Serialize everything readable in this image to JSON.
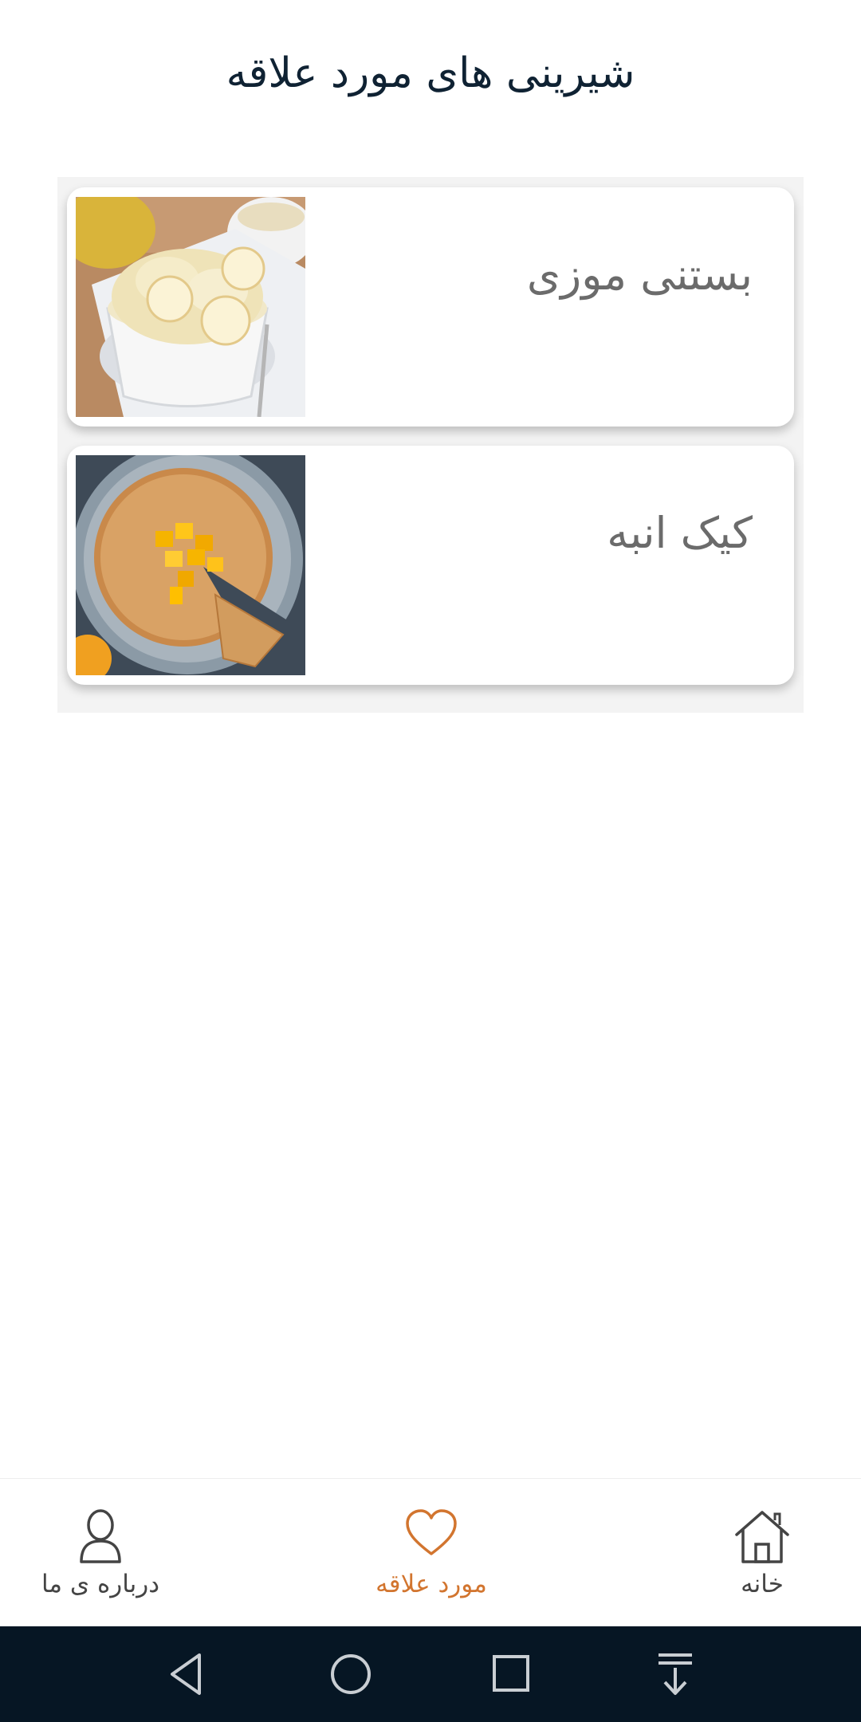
{
  "page": {
    "title": "شیرینی های مورد علاقه"
  },
  "favorites": [
    {
      "name": "بستنی موزی"
    },
    {
      "name": "کیک انبه"
    }
  ],
  "bottom_nav": {
    "items": [
      {
        "label": "خانه",
        "icon": "home-icon",
        "active": false
      },
      {
        "label": "مورد علاقه",
        "icon": "heart-icon",
        "active": true
      },
      {
        "label": "درباره ی ما",
        "icon": "user-icon",
        "active": false
      }
    ],
    "active_color": "#d2752f",
    "inactive_color": "#444444"
  },
  "system_nav": {
    "icons": [
      "back-icon",
      "home-circle-icon",
      "recents-icon",
      "notifications-pull-icon"
    ],
    "background": "#061624"
  }
}
